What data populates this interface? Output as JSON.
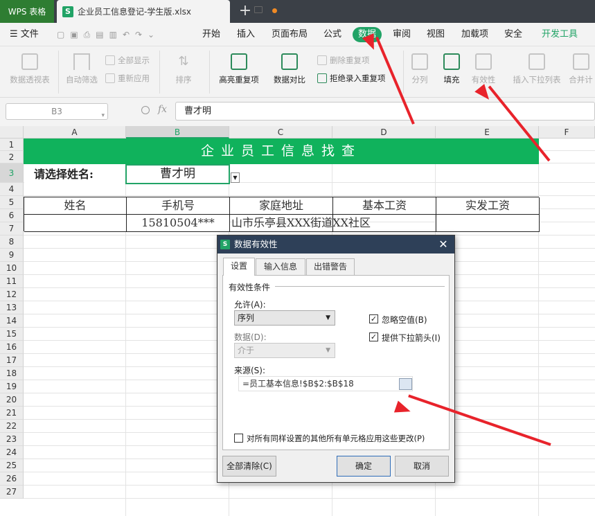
{
  "titlebar": {
    "app_tab": "WPS 表格",
    "file_tab": "企业员工信息登记-学生版.xlsx",
    "file_icon_letter": "S",
    "new_tab_symbol": "+"
  },
  "menubar": {
    "file_label": "文件",
    "items": [
      "开始",
      "插入",
      "页面布局",
      "公式",
      "数据",
      "审阅",
      "视图",
      "加载项",
      "安全",
      "开发工具"
    ],
    "active": "数据",
    "accent": "#21a366"
  },
  "ribbon": {
    "pivot": "数据透视表",
    "autofilter": "自动筛选",
    "show_all": "全部显示",
    "reapply": "重新应用",
    "sort": "排序",
    "highlight_dup": "高亮重复项",
    "data_compare": "数据对比",
    "delete_dup": "删除重复项",
    "reject_dup": "拒绝录入重复项",
    "split": "分列",
    "fill": "填充",
    "validity": "有效性",
    "insert_dropdown": "插入下拉列表",
    "merge_calc": "合并计"
  },
  "formula_bar": {
    "name_box": "B3",
    "fx": "fx",
    "formula": "曹才明"
  },
  "sheet": {
    "columns": [
      "A",
      "B",
      "C",
      "D",
      "E",
      "F"
    ],
    "selected_column": "B",
    "selected_row": "3",
    "rows": [
      "1",
      "2",
      "3",
      "4",
      "5",
      "6",
      "7",
      "8",
      "9",
      "10",
      "11",
      "12",
      "13",
      "14",
      "15",
      "16",
      "17",
      "18",
      "19",
      "20",
      "21",
      "22",
      "23",
      "24",
      "25",
      "26",
      "27"
    ],
    "banner": "企业员工信息找查",
    "label_a3": "请选择姓名:",
    "cell_b3": "曹才明",
    "table_headers": [
      "姓名",
      "手机号",
      "家庭地址",
      "基本工资",
      "实发工资"
    ],
    "table_row": [
      "",
      "15810504***",
      "山市乐亭县XXX街道XX社区",
      "",
      ""
    ]
  },
  "dialog": {
    "title": "数据有效性",
    "tabs": [
      "设置",
      "输入信息",
      "出错警告"
    ],
    "active_tab": "设置",
    "section": "有效性条件",
    "allow_label": "允许(A):",
    "allow_value": "序列",
    "data_label": "数据(D):",
    "data_value": "介于",
    "ignore_blank": "忽略空值(B)",
    "ignore_blank_checked": true,
    "show_dropdown": "提供下拉箭头(I)",
    "show_dropdown_checked": true,
    "source_label": "来源(S):",
    "source_value": "=员工基本信息!$B$2:$B$18",
    "apply_all": "对所有同样设置的其他所有单元格应用这些更改(P)",
    "apply_all_checked": false,
    "clear_all": "全部清除(C)",
    "ok": "确定",
    "cancel": "取消"
  },
  "colors": {
    "banner": "#10b25c",
    "annotation_arrow": "#e8232b",
    "titlebar": "#3b4047",
    "dialog_title": "#2e4058"
  }
}
